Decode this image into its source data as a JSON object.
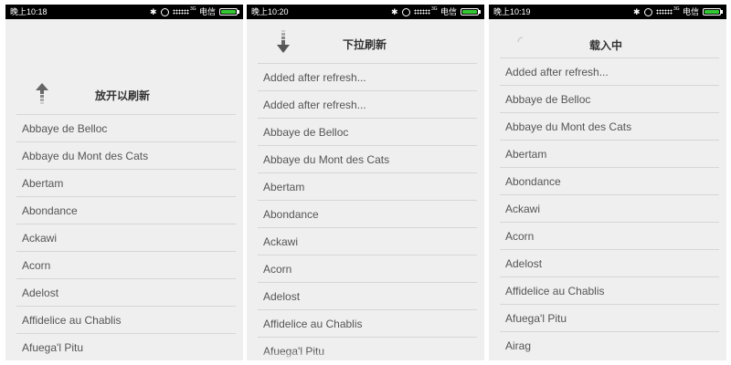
{
  "panels": [
    {
      "status_time": "晚上10:18",
      "carrier": "电信",
      "header_label": "放开以刷新",
      "header_icon": "arrow-up-icon",
      "items": [
        "Abbaye de Belloc",
        "Abbaye du Mont des Cats",
        "Abertam",
        "Abondance",
        "Ackawi",
        "Acorn",
        "Adelost",
        "Affidelice au Chablis",
        "Afuega'l Pitu"
      ]
    },
    {
      "status_time": "晚上10:20",
      "carrier": "电信",
      "header_label": "下拉刷新",
      "header_icon": "arrow-down-icon",
      "items": [
        "Added after refresh...",
        "Added after refresh...",
        "Abbaye de Belloc",
        "Abbaye du Mont des Cats",
        "Abertam",
        "Abondance",
        "Ackawi",
        "Acorn",
        "Adelost",
        "Affidelice au Chablis",
        "Afuega'l Pitu"
      ]
    },
    {
      "status_time": "晚上10:19",
      "carrier": "电信",
      "header_label": "载入中",
      "header_icon": "loading-spinner-icon",
      "items": [
        "Added after refresh...",
        "Abbaye de Belloc",
        "Abbaye du Mont des Cats",
        "Abertam",
        "Abondance",
        "Ackawi",
        "Acorn",
        "Adelost",
        "Affidelice au Chablis",
        "Afuega'l Pitu",
        "Airag"
      ]
    }
  ],
  "status_icons": [
    "bluetooth-icon",
    "alarm-icon",
    "signal-icon",
    "battery-icon"
  ],
  "network_label": "3G",
  "colors": {
    "battery": "#32c832",
    "background": "#efefef",
    "divider": "#d6d6d6"
  }
}
